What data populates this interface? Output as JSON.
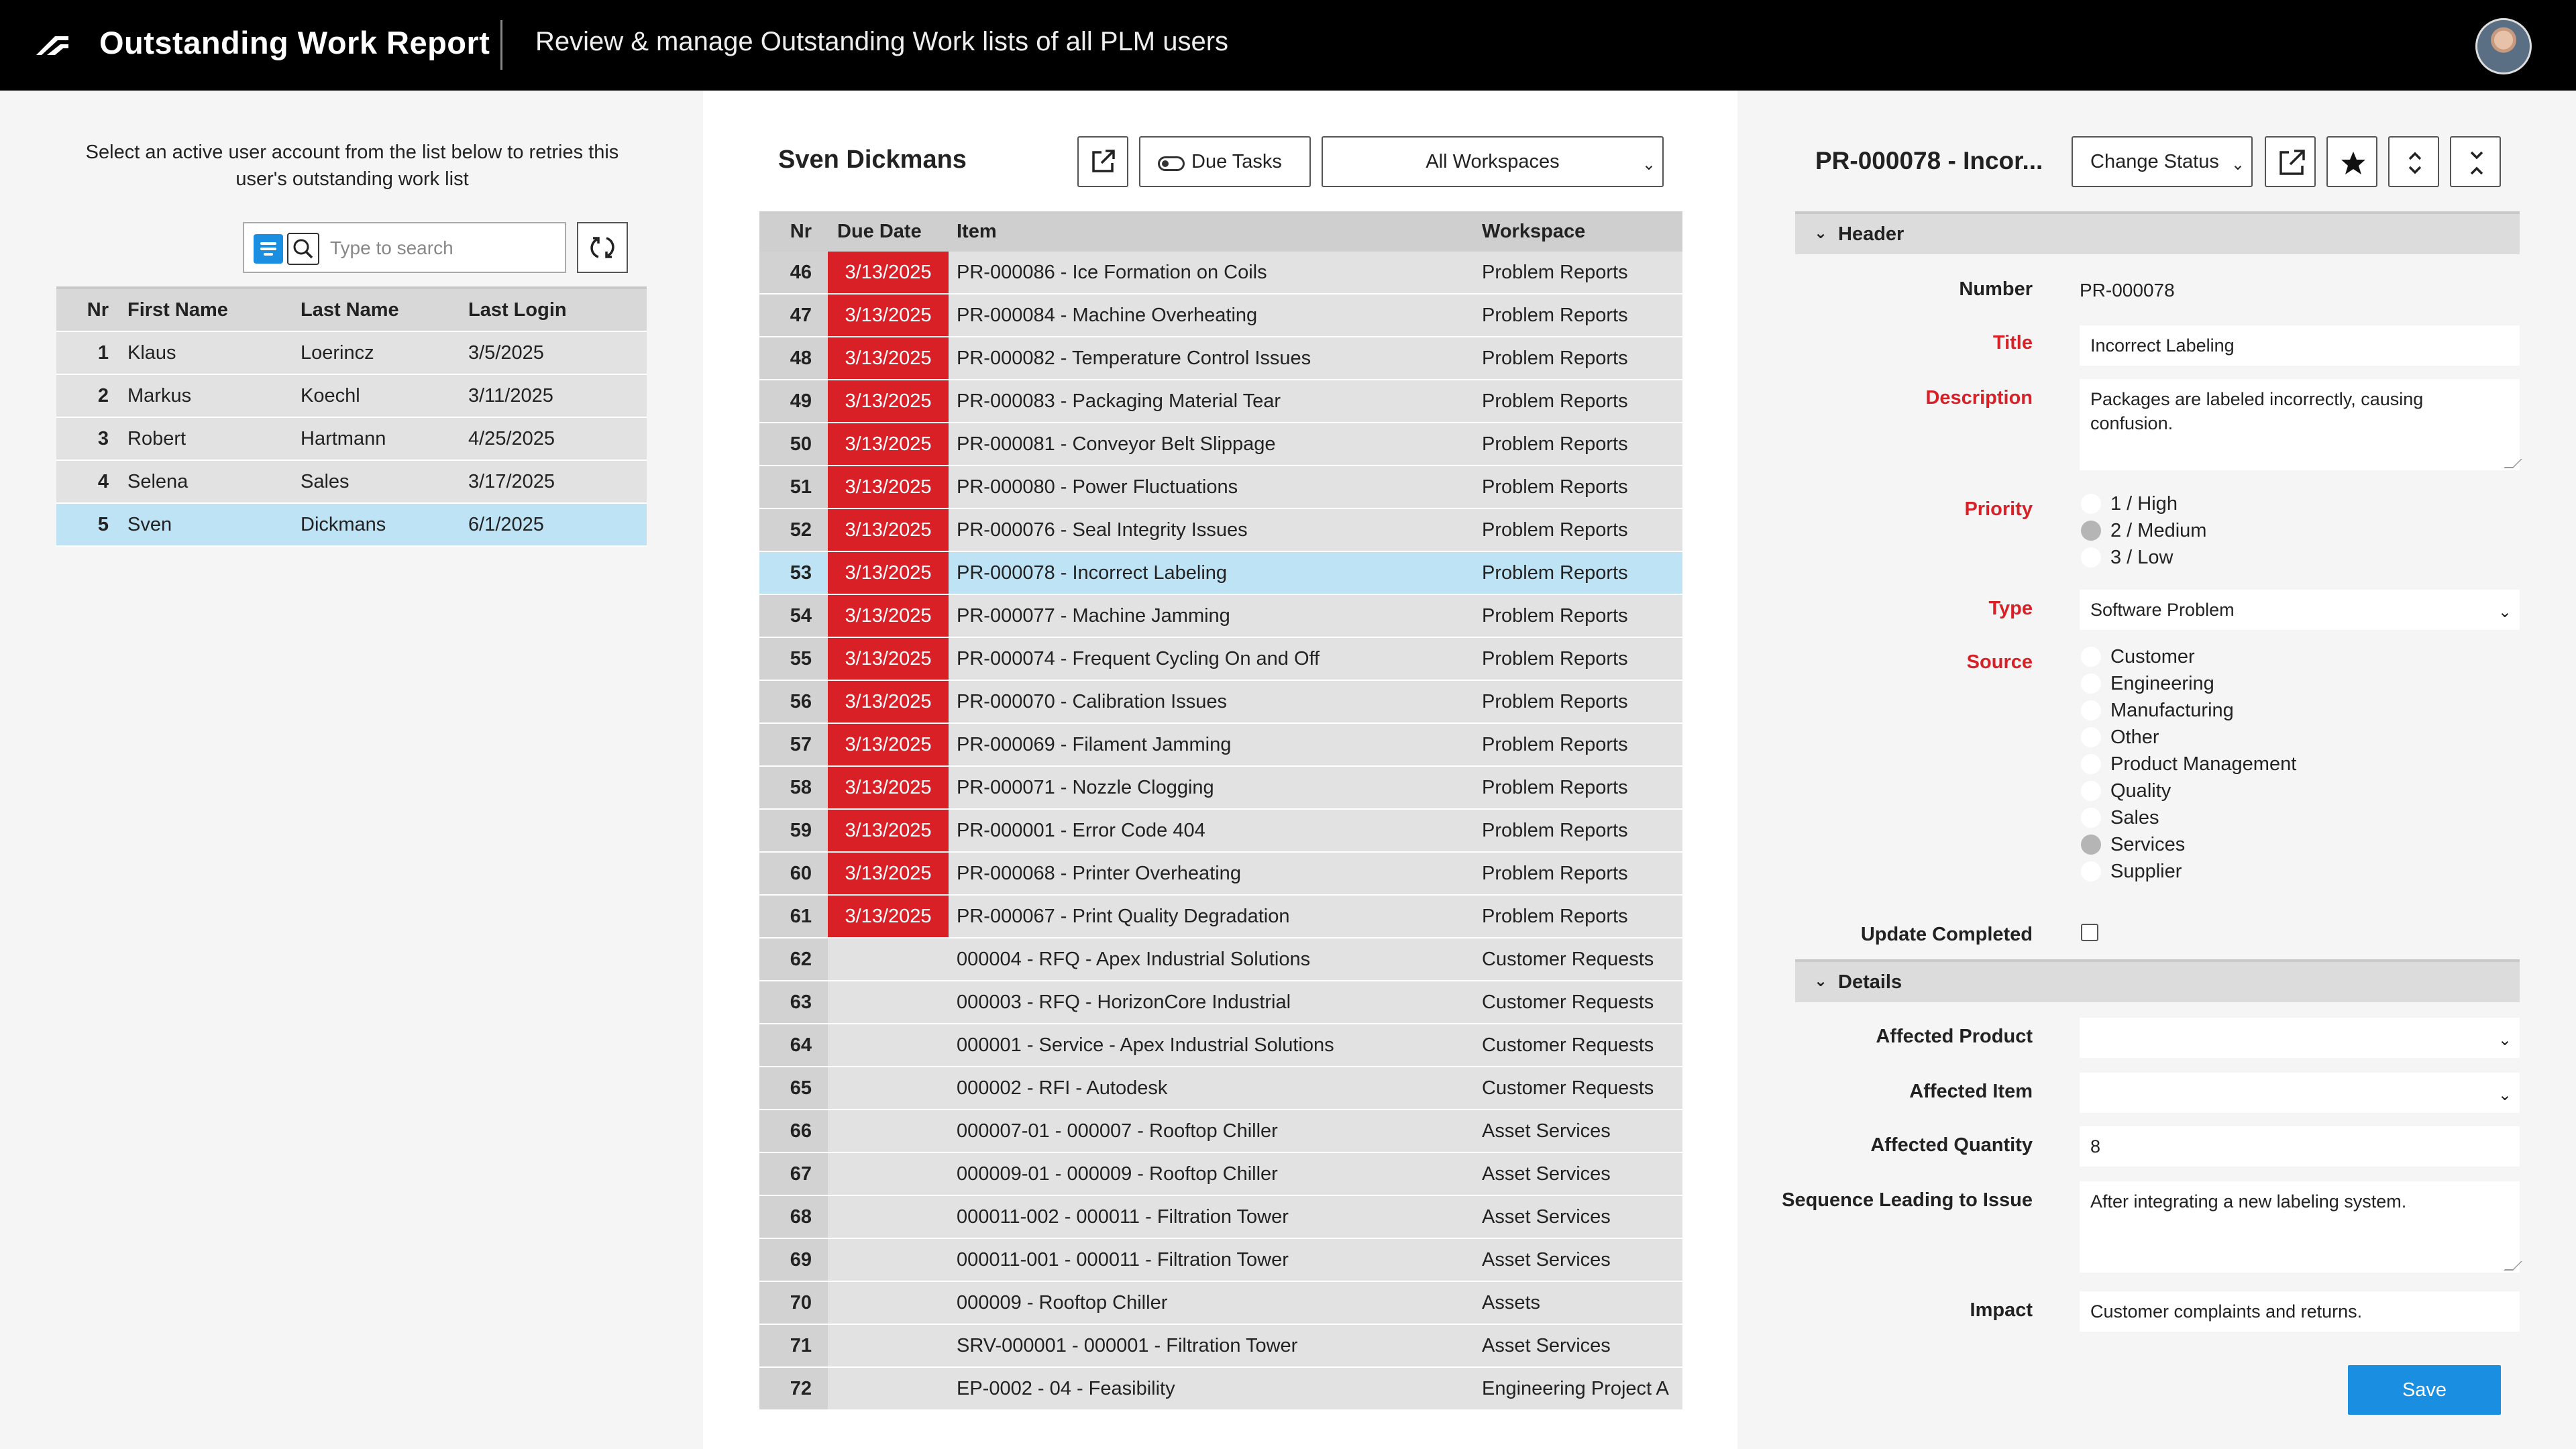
{
  "header": {
    "app_title": "Outstanding Work Report",
    "subtitle": "Review & manage Outstanding Work lists of all PLM users"
  },
  "left": {
    "instructions": "Select an active user account from the list below to retries this user's outstanding work list",
    "search_placeholder": "Type to search",
    "columns": {
      "nr": "Nr",
      "first": "First Name",
      "last": "Last Name",
      "login": "Last Login"
    },
    "users": [
      {
        "nr": "1",
        "first": "Klaus",
        "last": "Loerincz",
        "login": "3/5/2025"
      },
      {
        "nr": "2",
        "first": "Markus",
        "last": "Koechl",
        "login": "3/11/2025"
      },
      {
        "nr": "3",
        "first": "Robert",
        "last": "Hartmann",
        "login": "4/25/2025"
      },
      {
        "nr": "4",
        "first": "Selena",
        "last": "Sales",
        "login": "3/17/2025"
      },
      {
        "nr": "5",
        "first": "Sven",
        "last": "Dickmans",
        "login": "6/1/2025"
      }
    ],
    "selected_user": "5"
  },
  "middle": {
    "user_name": "Sven Dickmans",
    "due_tasks_label": "Due Tasks",
    "workspace_filter": "All Workspaces",
    "columns": {
      "nr": "Nr",
      "due": "Due Date",
      "item": "Item",
      "ws": "Workspace"
    },
    "tasks": [
      {
        "nr": "46",
        "due": "3/13/2025",
        "item": "PR-000086 - Ice Formation on Coils",
        "ws": "Problem Reports"
      },
      {
        "nr": "47",
        "due": "3/13/2025",
        "item": "PR-000084 - Machine Overheating",
        "ws": "Problem Reports"
      },
      {
        "nr": "48",
        "due": "3/13/2025",
        "item": "PR-000082 - Temperature Control Issues",
        "ws": "Problem Reports"
      },
      {
        "nr": "49",
        "due": "3/13/2025",
        "item": "PR-000083 - Packaging Material Tear",
        "ws": "Problem Reports"
      },
      {
        "nr": "50",
        "due": "3/13/2025",
        "item": "PR-000081 - Conveyor Belt Slippage",
        "ws": "Problem Reports"
      },
      {
        "nr": "51",
        "due": "3/13/2025",
        "item": "PR-000080 - Power Fluctuations",
        "ws": "Problem Reports"
      },
      {
        "nr": "52",
        "due": "3/13/2025",
        "item": "PR-000076 - Seal Integrity Issues",
        "ws": "Problem Reports"
      },
      {
        "nr": "53",
        "due": "3/13/2025",
        "item": "PR-000078 - Incorrect Labeling",
        "ws": "Problem Reports"
      },
      {
        "nr": "54",
        "due": "3/13/2025",
        "item": "PR-000077 - Machine Jamming",
        "ws": "Problem Reports"
      },
      {
        "nr": "55",
        "due": "3/13/2025",
        "item": "PR-000074 - Frequent Cycling On and Off",
        "ws": "Problem Reports"
      },
      {
        "nr": "56",
        "due": "3/13/2025",
        "item": "PR-000070 - Calibration Issues",
        "ws": "Problem Reports"
      },
      {
        "nr": "57",
        "due": "3/13/2025",
        "item": "PR-000069 - Filament Jamming",
        "ws": "Problem Reports"
      },
      {
        "nr": "58",
        "due": "3/13/2025",
        "item": "PR-000071 - Nozzle Clogging",
        "ws": "Problem Reports"
      },
      {
        "nr": "59",
        "due": "3/13/2025",
        "item": "PR-000001 - Error Code 404",
        "ws": "Problem Reports"
      },
      {
        "nr": "60",
        "due": "3/13/2025",
        "item": "PR-000068 - Printer Overheating",
        "ws": "Problem Reports"
      },
      {
        "nr": "61",
        "due": "3/13/2025",
        "item": "PR-000067 - Print Quality Degradation",
        "ws": "Problem Reports"
      },
      {
        "nr": "62",
        "due": "",
        "item": "000004 - RFQ - Apex Industrial Solutions",
        "ws": "Customer Requests"
      },
      {
        "nr": "63",
        "due": "",
        "item": "000003 - RFQ - HorizonCore Industrial",
        "ws": "Customer Requests"
      },
      {
        "nr": "64",
        "due": "",
        "item": "000001 - Service - Apex Industrial Solutions",
        "ws": "Customer Requests"
      },
      {
        "nr": "65",
        "due": "",
        "item": "000002 - RFI - Autodesk",
        "ws": "Customer Requests"
      },
      {
        "nr": "66",
        "due": "",
        "item": "000007-01 - 000007 - Rooftop Chiller",
        "ws": "Asset Services"
      },
      {
        "nr": "67",
        "due": "",
        "item": "000009-01 - 000009 - Rooftop Chiller",
        "ws": "Asset Services"
      },
      {
        "nr": "68",
        "due": "",
        "item": "000011-002 - 000011 - Filtration Tower",
        "ws": "Asset Services"
      },
      {
        "nr": "69",
        "due": "",
        "item": "000011-001 - 000011 - Filtration Tower",
        "ws": "Asset Services"
      },
      {
        "nr": "70",
        "due": "",
        "item": "000009 - Rooftop Chiller",
        "ws": "Assets"
      },
      {
        "nr": "71",
        "due": "",
        "item": "SRV-000001 - 000001 - Filtration Tower",
        "ws": "Asset Services"
      },
      {
        "nr": "72",
        "due": "",
        "item": "EP-0002 - 04 - Feasibility",
        "ws": "Engineering Project A"
      }
    ],
    "selected_task": "53",
    "overdue_color": "#d92027",
    "selection_color": "#bde3f5"
  },
  "right": {
    "item_title": "PR-000078 - Incor...",
    "change_status_label": "Change Status",
    "sections": {
      "header": "Header",
      "details": "Details"
    },
    "fields": {
      "number_label": "Number",
      "number_value": "PR-000078",
      "title_label": "Title",
      "title_value": "Incorrect Labeling",
      "description_label": "Description",
      "description_value": "Packages are labeled incorrectly, causing confusion.",
      "priority_label": "Priority",
      "priority_options": [
        "1 / High",
        "2 / Medium",
        "3 / Low"
      ],
      "priority_selected": "2 / Medium",
      "type_label": "Type",
      "type_value": "Software Problem",
      "source_label": "Source",
      "source_options": [
        "Customer",
        "Engineering",
        "Manufacturing",
        "Other",
        "Product Management",
        "Quality",
        "Sales",
        "Services",
        "Supplier"
      ],
      "source_selected": "Services",
      "update_completed_label": "Update Completed",
      "update_completed": false,
      "affected_product_label": "Affected Product",
      "affected_product_value": "",
      "affected_item_label": "Affected Item",
      "affected_item_value": "",
      "affected_quantity_label": "Affected Quantity",
      "affected_quantity_value": "8",
      "sequence_label": "Sequence Leading to Issue",
      "sequence_value": "After integrating a new labeling system.",
      "impact_label": "Impact",
      "impact_value": "Customer complaints and returns."
    },
    "save_label": "Save",
    "accent_color": "#1a8ee0",
    "required_color": "#d92027"
  }
}
